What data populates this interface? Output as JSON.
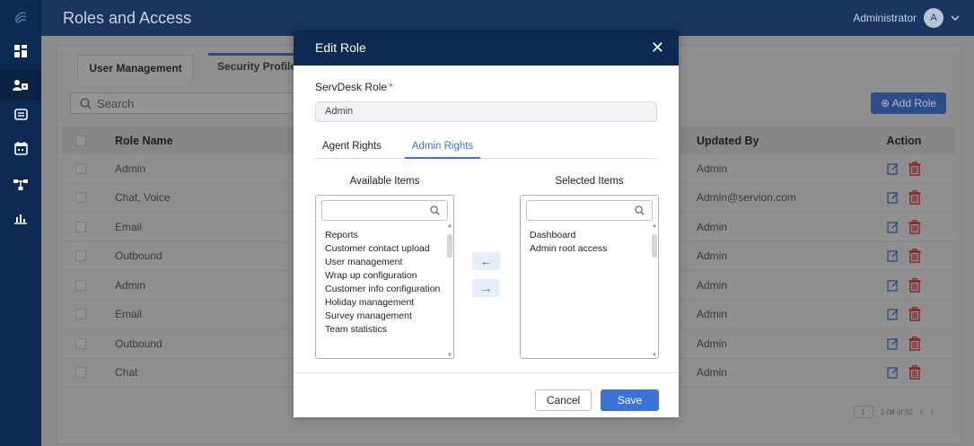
{
  "app": {
    "title": "Roles and Access",
    "user_name": "Administrator",
    "avatar_initial": "A"
  },
  "sidebar": {
    "items": [
      {
        "icon": "logo-icon"
      },
      {
        "icon": "dashboard-icon"
      },
      {
        "icon": "user-access-icon",
        "active": true
      },
      {
        "icon": "message-icon"
      },
      {
        "icon": "calendar-icon"
      },
      {
        "icon": "workflow-icon"
      },
      {
        "icon": "reports-chart-icon"
      }
    ]
  },
  "page": {
    "tabs": [
      "User Management",
      "Security Profile"
    ],
    "search_placeholder": "Search",
    "add_role_label": "⊕ Add Role",
    "table": {
      "headers": {
        "name": "Role Name",
        "updated_by": "Updated By",
        "action": "Action"
      },
      "rows": [
        {
          "name": "Admin",
          "updated_by": "Admin"
        },
        {
          "name": "Chat, Voice",
          "updated_by": "Admin@servion.com"
        },
        {
          "name": "Email",
          "updated_by": "Admin"
        },
        {
          "name": "Outbound",
          "updated_by": "Admin"
        },
        {
          "name": "Admin",
          "updated_by": "Admin"
        },
        {
          "name": "Email",
          "updated_by": "Admin"
        },
        {
          "name": "Outbound",
          "updated_by": "Admin"
        },
        {
          "name": "Chat",
          "updated_by": "Admin"
        }
      ]
    },
    "pager": {
      "page": "1",
      "range": "1-08 of 50"
    }
  },
  "modal": {
    "title": "Edit Role",
    "close_glyph": "✕",
    "role_label": "ServDesk Role",
    "required_mark": "*",
    "role_value": "Admin",
    "tabs": {
      "agent": "Agent Rights",
      "admin": "Admin Rights"
    },
    "available": {
      "title": "Available Items",
      "items": [
        "Reports",
        "Customer contact upload",
        "User management",
        "Wrap up configuration",
        "Customer info configuration",
        "Holiday management",
        "Survey management",
        "Team statistics"
      ]
    },
    "selected": {
      "title": "Selected Items",
      "items": [
        "Dashboard",
        "Admin root access"
      ]
    },
    "move_left": "←",
    "move_right": "→",
    "cancel_label": "Cancel",
    "save_label": "Save"
  },
  "colors": {
    "sidebar": "#0d2a52",
    "accent": "#3b73d9",
    "delete": "#e53935"
  }
}
